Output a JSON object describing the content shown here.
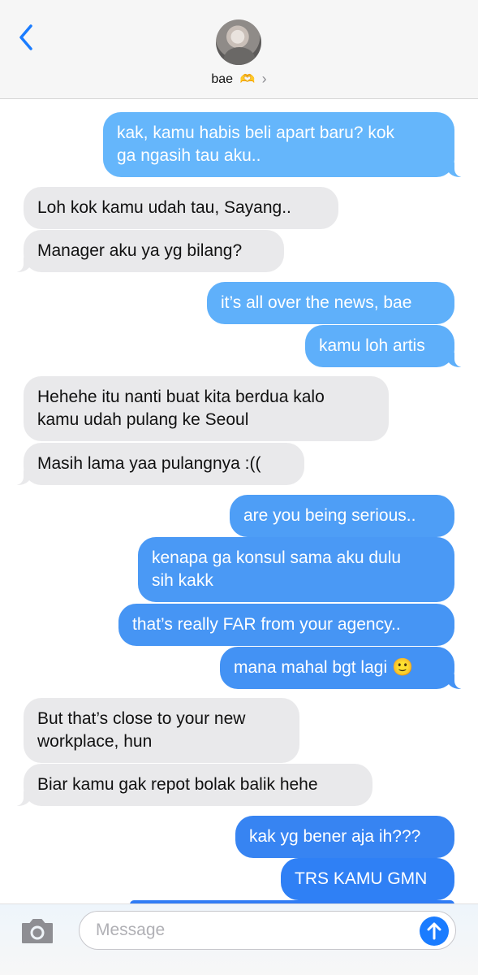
{
  "contact": {
    "name": "bae",
    "emoji": "🫶",
    "chevron": "›"
  },
  "icons": {
    "back": "chevron-left-icon",
    "camera": "camera-icon",
    "send": "arrow-up-icon"
  },
  "colors": {
    "accent": "#1a7cff",
    "incoming_bubble": "#e9e9eb",
    "outgoing_top": "#65b6fb",
    "outgoing_bottom": "#2f80f5"
  },
  "messages": [
    {
      "dir": "out",
      "text": "kak, kamu habis beli apart baru? kok\nga ngasih tau aku.."
    },
    {
      "dir": "in",
      "text": "Loh kok kamu udah tau, Sayang.."
    },
    {
      "dir": "in",
      "text": "Manager aku ya yg bilang?"
    },
    {
      "dir": "out",
      "text": "it’s all over the news, bae"
    },
    {
      "dir": "out",
      "text": "kamu loh artis"
    },
    {
      "dir": "in",
      "text": "Hehehe itu nanti buat kita berdua kalo\nkamu udah pulang ke Seoul"
    },
    {
      "dir": "in",
      "text": "Masih lama yaa pulangnya :(("
    },
    {
      "dir": "out",
      "text": "are you being serious.."
    },
    {
      "dir": "out",
      "text": "kenapa ga konsul sama aku dulu\nsih kakk"
    },
    {
      "dir": "out",
      "text": "that’s really FAR from your agency.."
    },
    {
      "dir": "out",
      "text": "mana mahal bgt lagi 🙂"
    },
    {
      "dir": "in",
      "text": "But that’s close to your new\nworkplace, hun"
    },
    {
      "dir": "in",
      "text": "Biar kamu gak repot bolak balik hehe"
    },
    {
      "dir": "out",
      "text": "kak yg bener aja ih???"
    },
    {
      "dir": "out",
      "text": "TRS KAMU GMN"
    }
  ],
  "composer": {
    "placeholder": "Message"
  }
}
